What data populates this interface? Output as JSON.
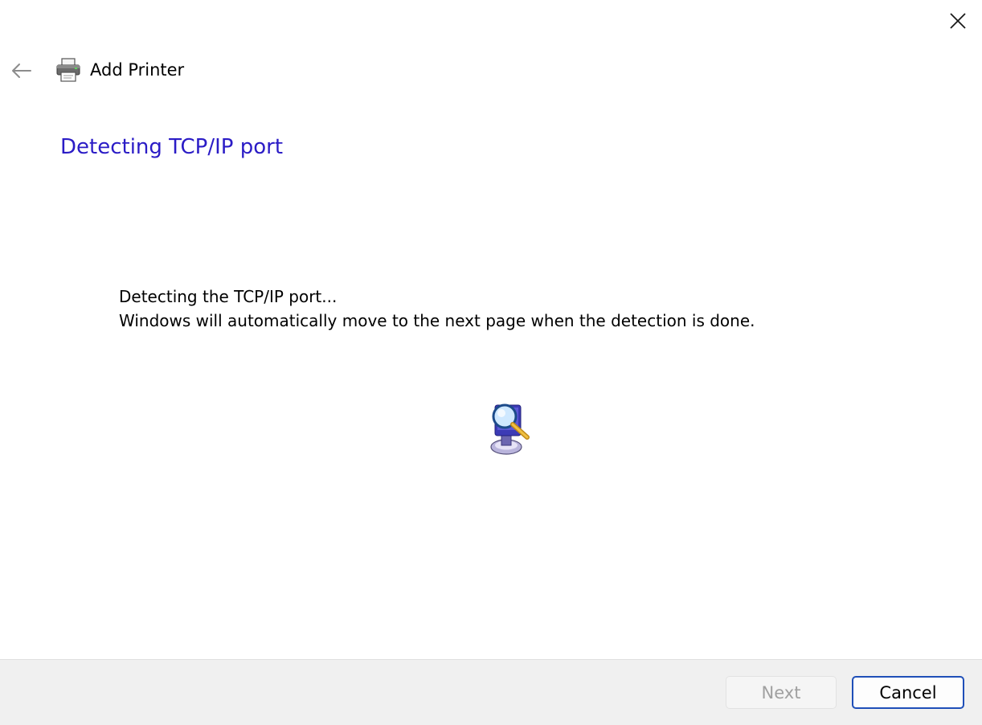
{
  "window": {
    "close_icon": "close-icon"
  },
  "header": {
    "back_icon": "back-arrow-icon",
    "app_icon": "printer-icon",
    "title": "Add Printer"
  },
  "main": {
    "heading": "Detecting TCP/IP port",
    "message_line1": "Detecting the TCP/IP port...",
    "message_line2": "Windows will automatically move to the next page when the detection is done.",
    "animation_icon": "search-computer-icon"
  },
  "footer": {
    "next_label": "Next",
    "cancel_label": "Cancel"
  },
  "colors": {
    "heading": "#2b1cc6",
    "footer_bg": "#f0f0f0",
    "cancel_border": "#1f4fb8",
    "disabled_text": "#a0a0a0"
  }
}
